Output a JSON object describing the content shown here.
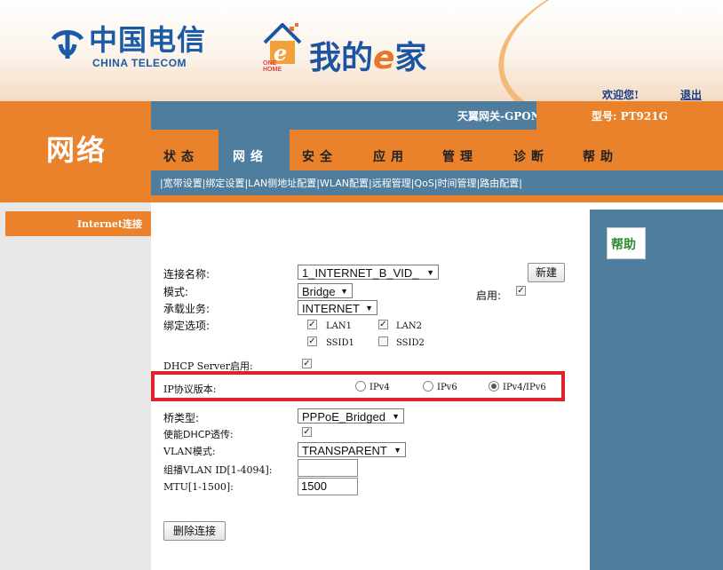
{
  "header": {
    "telecom_cn": "中国电信",
    "telecom_en": "CHINA TELECOM",
    "one_home": "ONE HOME",
    "home_title_pre": "我的",
    "home_title_e": "e",
    "home_title_post": "家",
    "welcome": "欢迎您!",
    "logout": "退出"
  },
  "topbar": {
    "section_title": "网络",
    "gateway_name": "天翼网关-GPON",
    "model": "型号: PT921G"
  },
  "main_tabs": [
    {
      "label": "状态"
    },
    {
      "label": "网络"
    },
    {
      "label": "安全"
    },
    {
      "label": "应用"
    },
    {
      "label": "管理"
    },
    {
      "label": "诊断"
    },
    {
      "label": "帮助"
    }
  ],
  "sub_tabs": [
    {
      "label": "宽带设置"
    },
    {
      "label": "绑定设置"
    },
    {
      "label": "LAN侧地址配置"
    },
    {
      "label": "WLAN配置"
    },
    {
      "label": "远程管理"
    },
    {
      "label": "QoS"
    },
    {
      "label": "时间管理"
    },
    {
      "label": "路由配置"
    }
  ],
  "sidebar": {
    "items": [
      {
        "label": "Internet连接"
      }
    ]
  },
  "help": {
    "label": "帮助"
  },
  "form": {
    "conn_name_label": "连接名称:",
    "conn_name_value": "1_INTERNET_B_VID_",
    "new_button": "新建",
    "mode_label": "模式:",
    "mode_value": "Bridge",
    "enable_label": "启用:",
    "enable_checked": true,
    "service_label": "承载业务:",
    "service_value": "INTERNET",
    "binding_label": "绑定选项:",
    "bind_options": [
      {
        "label": "LAN1",
        "checked": true
      },
      {
        "label": "LAN2",
        "checked": true
      },
      {
        "label": "SSID1",
        "checked": true
      },
      {
        "label": "SSID2",
        "checked": false
      }
    ],
    "dhcp_server_label": "DHCP Server启用:",
    "dhcp_server_checked": true,
    "ip_version_label": "IP协议版本:",
    "ip_versions": [
      {
        "label": "IPv4",
        "selected": false
      },
      {
        "label": "IPv6",
        "selected": false
      },
      {
        "label": "IPv4/IPv6",
        "selected": true
      }
    ],
    "bridge_type_label": "桥类型:",
    "bridge_type_value": "PPPoE_Bridged",
    "dhcp_passthrough_label": "使能DHCP透传:",
    "dhcp_passthrough_checked": true,
    "vlan_mode_label": "VLAN模式:",
    "vlan_mode_value": "TRANSPARENT",
    "mcast_vlan_label": "组播VLAN ID[1-4094]:",
    "mcast_vlan_value": "",
    "mtu_label": "MTU[1-1500]:",
    "mtu_value": "1500",
    "delete_button": "删除连接"
  },
  "colors": {
    "orange": "#e9822a",
    "steel_blue": "#4e7d9e",
    "highlight_red": "#e0222c",
    "help_green": "#2c8a2c",
    "brand_blue": "#1a5aa6"
  }
}
